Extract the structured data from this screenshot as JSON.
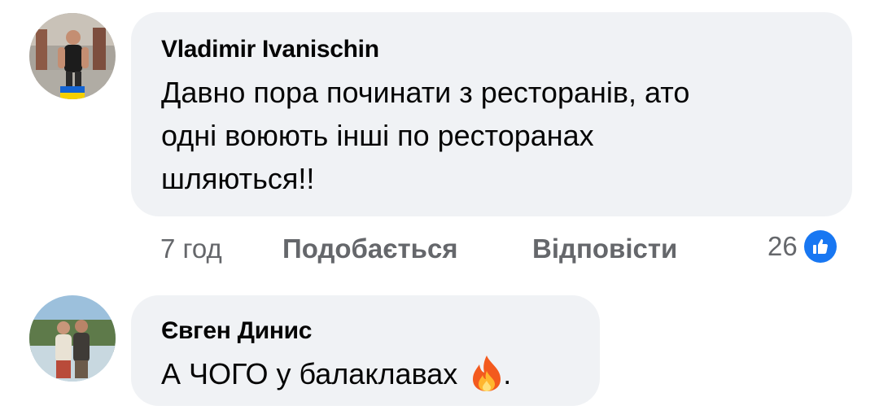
{
  "comments": [
    {
      "author": "Vladimir Ivanischin",
      "lines": [
        "Давно пора починати з ресторанів, ато",
        "одні воюють інші по ресторанах",
        "шляються!!"
      ],
      "time": "7 год",
      "like_label": "Подобається",
      "reply_label": "Відповісти",
      "reaction_count": "26",
      "reaction_icon": "like-icon"
    },
    {
      "author": "Євген Динис",
      "text": "А ЧОГО у балаклавах",
      "trailing": ".",
      "emoji_icon": "fire-icon"
    }
  ],
  "colors": {
    "bubble": "#f0f2f5",
    "meta": "#65676b",
    "like_blue": "#1877f2"
  }
}
